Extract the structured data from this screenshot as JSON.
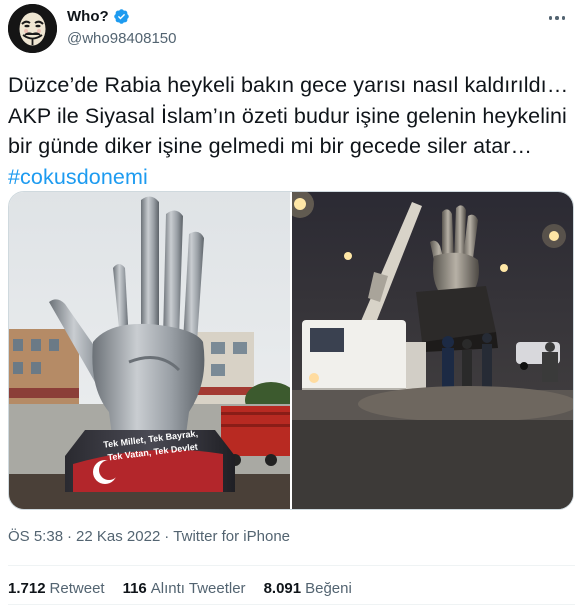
{
  "author": {
    "display_name": "Who?",
    "handle": "@who98408150",
    "avatar_icon": "guy-fawkes-mask-avatar",
    "verified_icon": "verified-badge-icon"
  },
  "tweet": {
    "text_before": "Düzce’de Rabia heykeli bakın gece yarısı nasıl kaldırıldı… AKP ile Siyasal İslam’ın özeti budur işine gelenin heykelini bir günde diker işine gelmedi mi bir gecede siler atar… ",
    "hashtag": "#cokusdonemi"
  },
  "media": {
    "left_image": {
      "sign_line1": "Tek Millet, Tek Bayrak,",
      "sign_line2": "Tek Vatan, Tek Devlet"
    },
    "right_image": {}
  },
  "meta": {
    "time": "ÖS 5:38",
    "separator1": "·",
    "date": "22 Kas 2022",
    "separator2": "·",
    "source": "Twitter for iPhone"
  },
  "stats": {
    "retweets_count": "1.712",
    "retweets_label": "Retweet",
    "quotes_count": "116",
    "quotes_label": "Alıntı Tweetler",
    "likes_count": "8.091",
    "likes_label": "Beğeni"
  },
  "colors": {
    "link": "#1d9bf0",
    "secondary_text": "#536471",
    "primary_text": "#0f1419",
    "divider": "#eff3f4"
  }
}
